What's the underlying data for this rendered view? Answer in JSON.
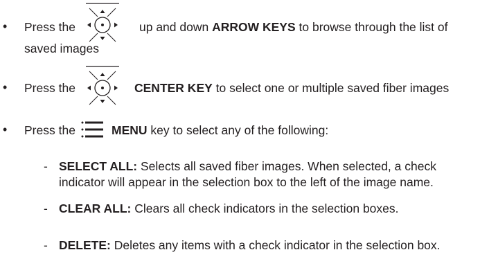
{
  "bullets": [
    {
      "prefix": "Press the",
      "icon": "arrow-keypad-icon",
      "text_before": "up and down ",
      "bold": "ARROW KEYS",
      "text_after": " to browse through the list of",
      "continuation": "saved images"
    },
    {
      "prefix": "Press the",
      "icon": "arrow-keypad-icon",
      "text_before": "",
      "bold": "CENTER KEY",
      "text_after": " to select one or multiple saved fiber images"
    },
    {
      "prefix": "Press the",
      "icon": "menu-icon",
      "text_before": "",
      "bold": "MENU",
      "text_after": " key to select any of the following:"
    }
  ],
  "menu_options": [
    {
      "label": "SELECT ALL:",
      "description_line1": " Selects all saved fiber images. When selected, a check",
      "description_line2": "indicator will appear in the selection box to the left of the image name."
    },
    {
      "label": "CLEAR ALL:",
      "description_line1": " Clears all check indicators in the selection boxes."
    },
    {
      "label": "DELETE:",
      "description_line1": " Deletes any items with a check indicator in the selection box."
    }
  ],
  "bullet_char": "•",
  "dash_char": "-"
}
